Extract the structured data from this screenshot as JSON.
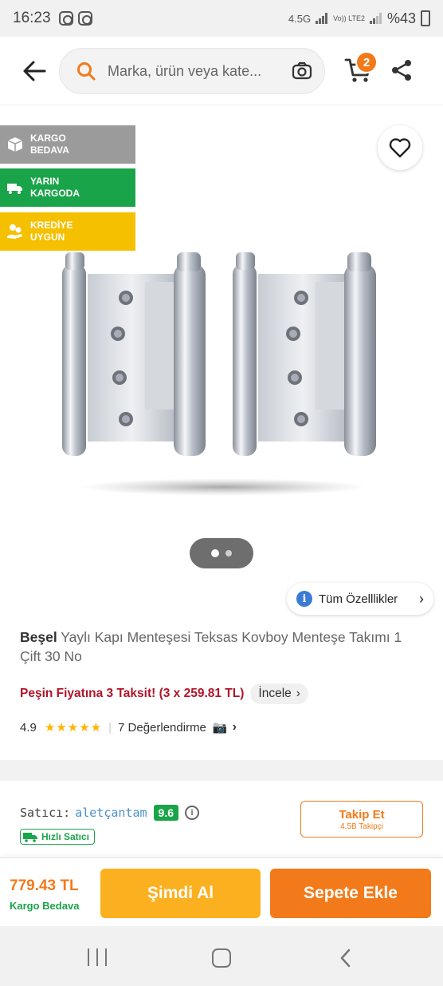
{
  "status_bar": {
    "time": "16:23",
    "network_label": "4.5G",
    "volte_label": "Vo)) LTE2",
    "battery": "%43"
  },
  "header": {
    "search_placeholder": "Marka, ürün veya kate...",
    "cart_count": "2"
  },
  "badges": {
    "kargo": "KARGO BEDAVA",
    "yarin": "YARIN KARGODA",
    "kredi": "KREDİYE UYGUN"
  },
  "gallery": {
    "current_index": 1,
    "total": 2
  },
  "specs_button": "Tüm Özelllikler",
  "product": {
    "brand": "Beşel",
    "name": "Yaylı Kapı Menteşesi Teksas Kovboy Menteşe Takımı 1 Çift 30 No",
    "installment_text": "Peşin Fiyatına 3 Taksit! (3 x 259.81 TL)",
    "installment_link": "İncele",
    "rating": "4.9",
    "stars": "★★★★★",
    "review_count": "7 Değerlendirme"
  },
  "seller": {
    "label": "Satıcı:",
    "name": "aletçantam",
    "score": "9.6",
    "fast_label": "Hızlı Satıcı",
    "follow_label": "Takip Et",
    "followers": "4,5B Takipçi"
  },
  "buybar": {
    "price": "779.43 TL",
    "shipping": "Kargo Bedava",
    "buy_now": "Şimdi Al",
    "add_to_cart": "Sepete Ekle"
  },
  "colors": {
    "accent": "#f27a1a",
    "buy_now": "#fbb01f",
    "green": "#1aa44a",
    "installment_red": "#b1152a"
  }
}
